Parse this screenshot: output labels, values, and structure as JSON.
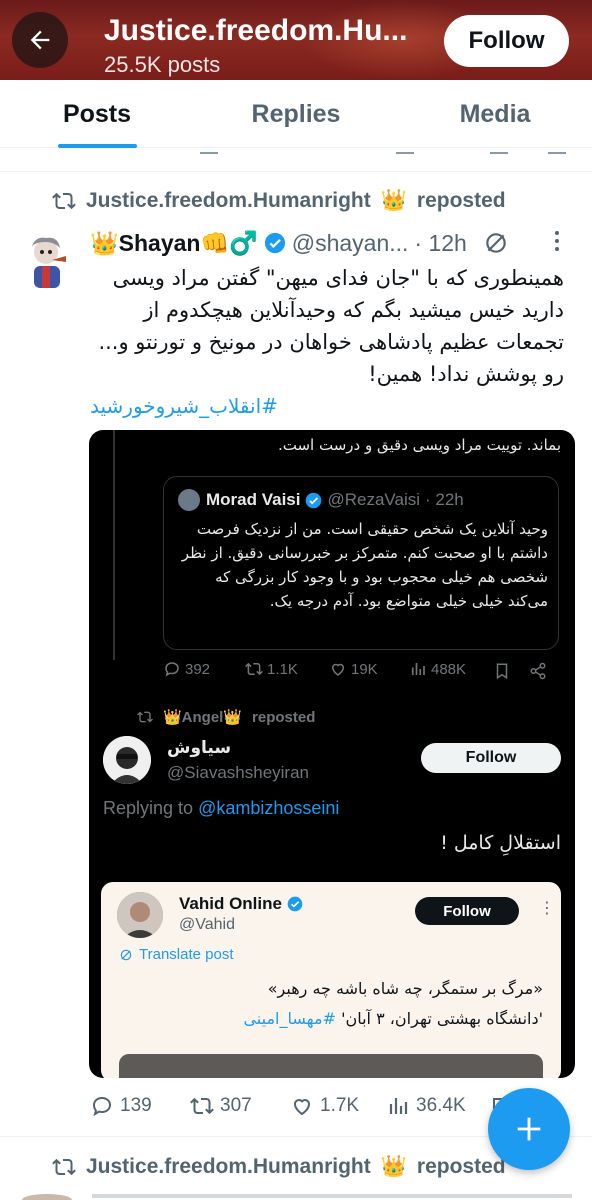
{
  "header": {
    "title": "Justice.freedom.Hu...",
    "post_count": "25.5K posts",
    "follow_label": "Follow"
  },
  "tabs": [
    {
      "label": "Posts",
      "active": true
    },
    {
      "label": "Replies",
      "active": false
    },
    {
      "label": "Media",
      "active": false
    }
  ],
  "tweet": {
    "repost_by": "Justice.freedom.Humanright",
    "repost_by_emoji": "👑",
    "repost_suffix": "reposted",
    "author_name": "👑Shayan👊♂️",
    "author_handle": "@shayan...",
    "time": "· 12h",
    "text": "همینطوری که با \"جان فدای میهن\" گفتن مراد ویسی دارید خیس میشید بگم که وحیدآنلاین هیچکدوم از تجمعات عظیم پادشاهی خواهان در مونیخ و تورنتو و... رو پوشش نداد! همین!",
    "hashtag": "#انقلاب_شیروخورشید",
    "embed": {
      "pre_text": "بماند. توییت مراد ویسی دقیق و درست است.",
      "quote": {
        "name": "Morad Vaisi",
        "handle": "@RezaVaisi",
        "time": "· 22h",
        "text": "وحید آنلاین یک شخص حقیقی است. من از نزدیک فرصت داشتم با او صحبت کنم. متمرکز بر خبررسانی دقیق. از نظر شخصی هم خیلی محجوب بود و با وجود کار بزرگی که می‌کند خیلی خیلی متواضع بود. آدم درجه یک."
      },
      "actions": {
        "replies": "392",
        "reposts": "1.1K",
        "likes": "19K",
        "views": "488K"
      },
      "repost_by": "👑Angel👑",
      "repost_suffix": "reposted",
      "user_name": "سیاوش",
      "user_handle": "@Siavashsheyiran",
      "follow_label": "Follow",
      "replying_prefix": "Replying to",
      "replying_to": "@kambizhosseini",
      "reply_text": "استقلالِ کامل !",
      "inner": {
        "name": "Vahid Online",
        "handle": "@Vahid",
        "follow_label": "Follow",
        "translate": "Translate post",
        "line1": "«مرگ بر ستمگر، چه شاه باشه چه رهبر»",
        "line2_prefix": "'دانشگاه بهشتی تهران، ۳ آبان'",
        "line2_tag": "#مهسا_امینی"
      }
    },
    "actions": {
      "replies": "139",
      "reposts": "307",
      "likes": "1.7K",
      "views": "36.4K"
    }
  },
  "next_tweet": {
    "repost_by": "Justice.freedom.Humanright",
    "repost_by_emoji": "👑",
    "repost_suffix": "reposted"
  },
  "colors": {
    "accent": "#1d9bf0",
    "header_bg": "#7a1c18",
    "muted": "#536471"
  }
}
